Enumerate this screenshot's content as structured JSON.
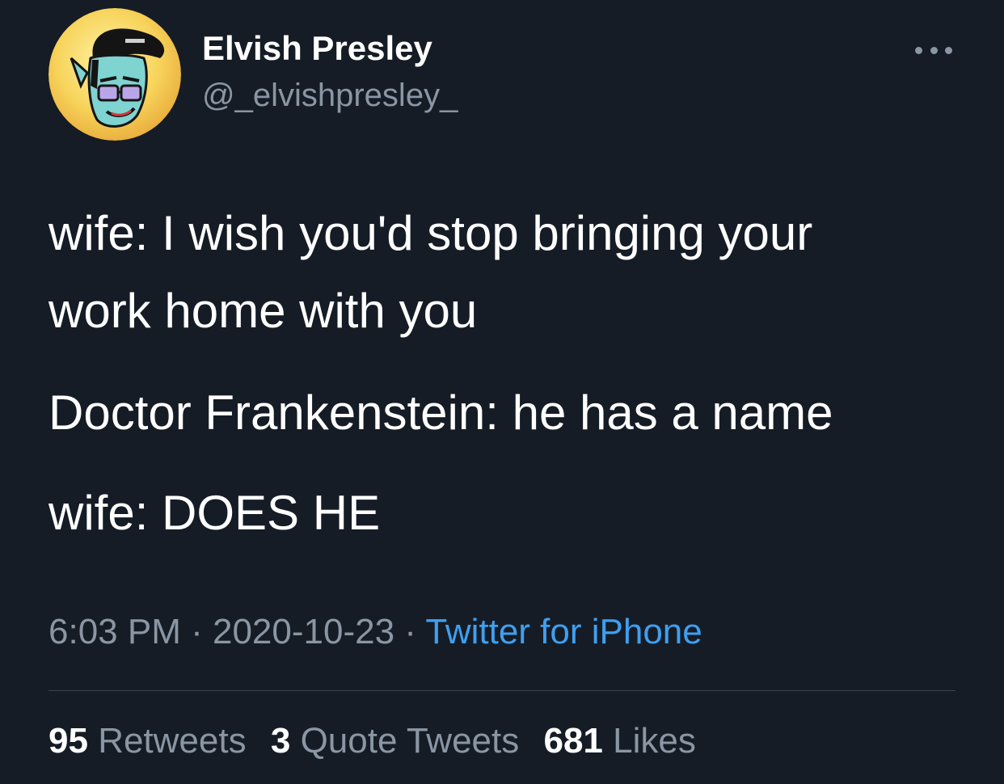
{
  "user": {
    "display_name": "Elvish Presley",
    "handle": "@_elvishpresley_",
    "avatar_icon": "cartoon-elf-avatar"
  },
  "tweet": {
    "lines": [
      "wife: I wish you'd stop bringing your",
      "work home with you",
      "Doctor Frankenstein: he has a name",
      "wife: DOES HE"
    ]
  },
  "meta": {
    "time": "6:03 PM",
    "separator": " · ",
    "date": "2020-10-23",
    "source": "Twitter for iPhone"
  },
  "stats": {
    "retweets_count": "95",
    "retweets_label": "Retweets",
    "quotes_count": "3",
    "quotes_label": "Quote Tweets",
    "likes_count": "681",
    "likes_label": "Likes"
  },
  "colors": {
    "background": "#161c25",
    "text": "#ffffff",
    "muted": "#8a96a3",
    "link": "#3f9ff0"
  }
}
